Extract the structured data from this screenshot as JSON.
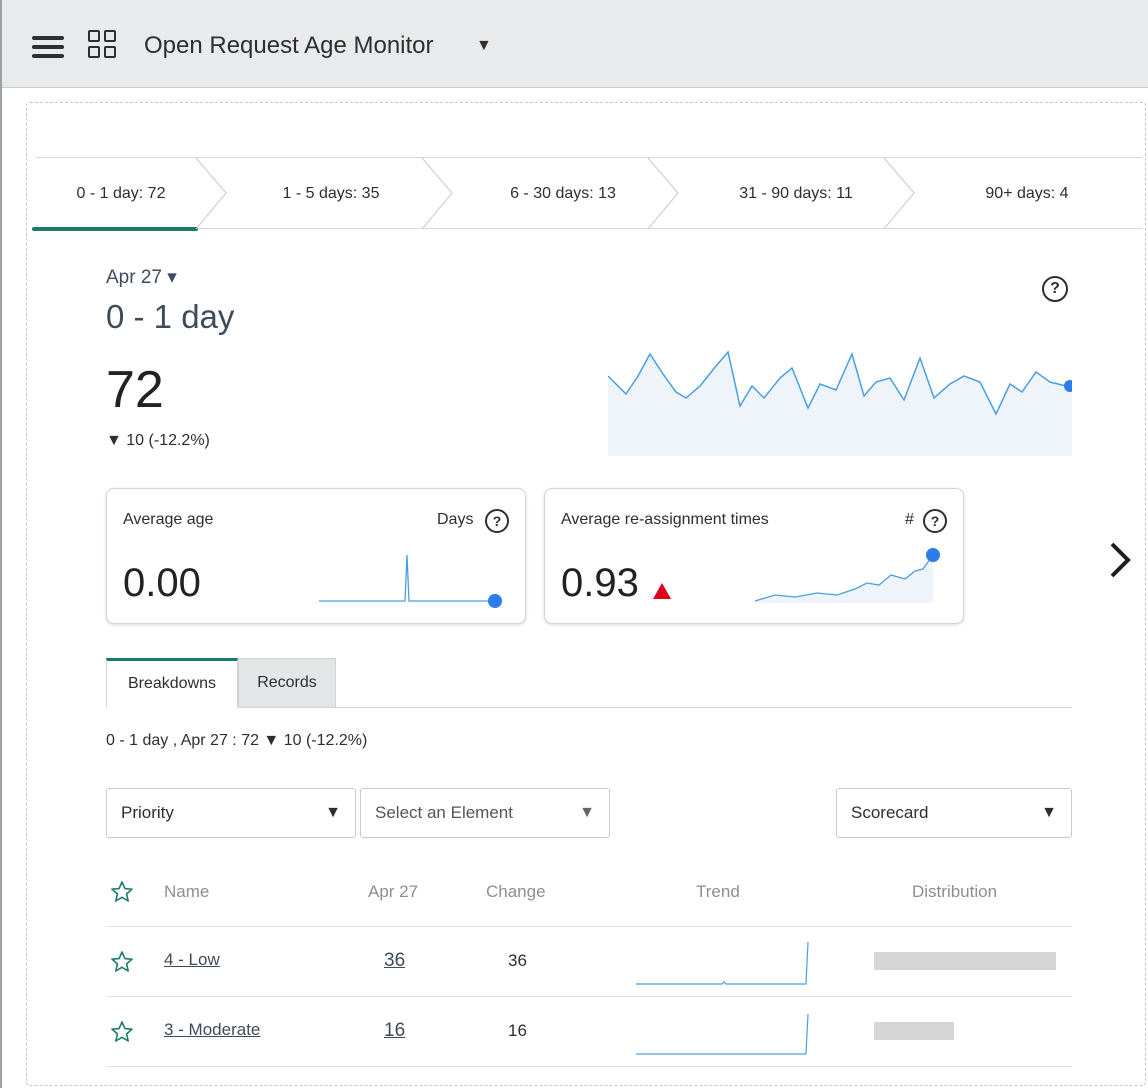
{
  "header": {
    "title": "Open Request Age Monitor",
    "caret": "▼"
  },
  "buckets": [
    {
      "label": "0 - 1 day: 72",
      "active": true
    },
    {
      "label": "1 - 5 days: 35",
      "active": false
    },
    {
      "label": "6 - 30 days: 13",
      "active": false
    },
    {
      "label": "31 - 90 days: 11",
      "active": false
    },
    {
      "label": "90+ days: 4",
      "active": false
    }
  ],
  "detail": {
    "date": "Apr 27",
    "date_caret": "▾",
    "range": "0 - 1 day",
    "value": "72",
    "delta": "▼ 10 (-12.2%)",
    "help": "?"
  },
  "cards": [
    {
      "title": "Average age",
      "unit": "Days",
      "value": "0.00",
      "help": "?"
    },
    {
      "title": "Average re-assignment times",
      "unit": "#",
      "value": "0.93",
      "help": "?"
    }
  ],
  "tabs": {
    "breakdowns": "Breakdowns",
    "records": "Records"
  },
  "summary": "0 - 1 day , Apr 27 : 72 ▼ 10 (-12.2%)",
  "filters": {
    "breakdown": "Priority",
    "element": "Select an Element",
    "view": "Scorecard",
    "caret": "▼"
  },
  "table": {
    "headers": {
      "name": "Name",
      "date": "Apr 27",
      "change": "Change",
      "trend": "Trend",
      "distribution": "Distribution"
    },
    "rows": [
      {
        "name": "4 - Low",
        "value": "36",
        "change": "36",
        "distribution": 1.0
      },
      {
        "name": "3 - Moderate",
        "value": "16",
        "change": "16",
        "distribution": 0.44
      }
    ]
  },
  "colors": {
    "accent": "#1c7a6b",
    "spark": "#4a9fe0",
    "marker": "#2b7de9",
    "down_up_red": "#e0001b"
  }
}
